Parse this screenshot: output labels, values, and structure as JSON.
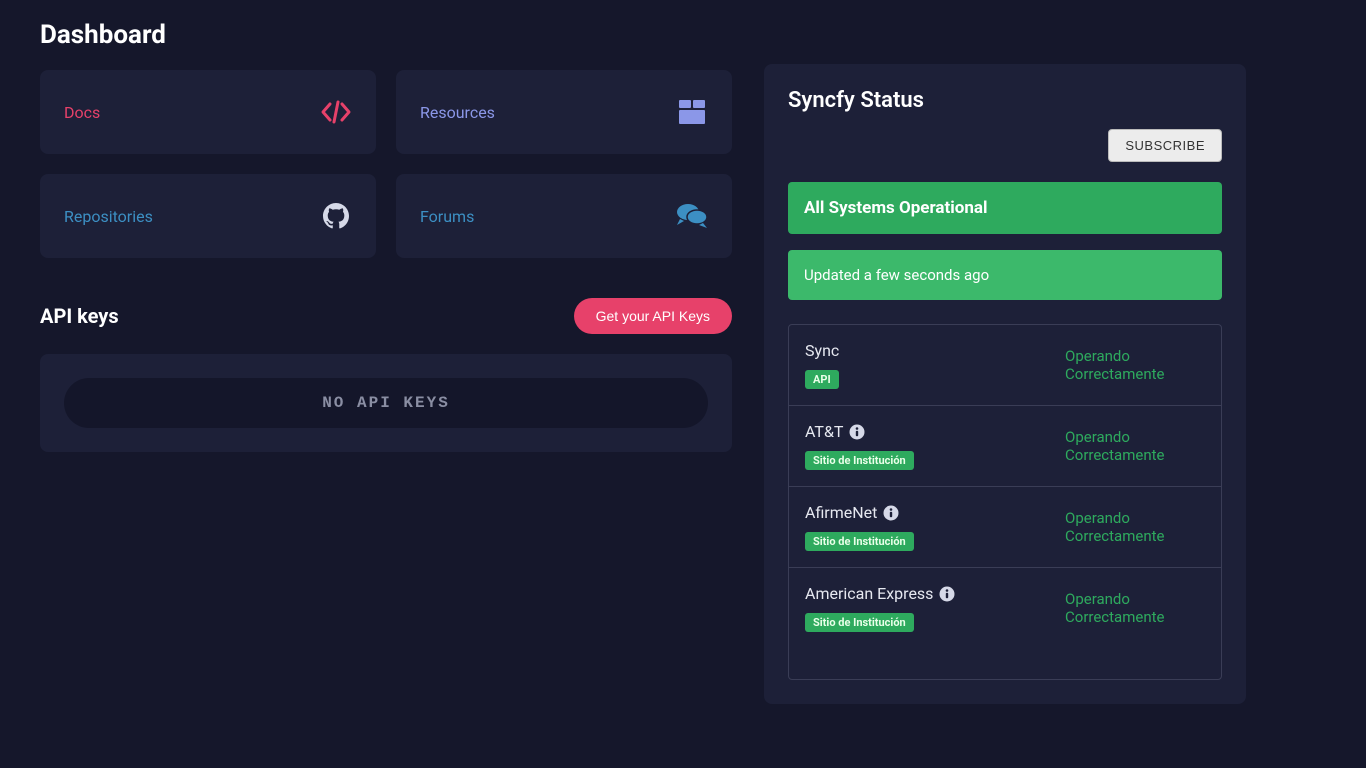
{
  "page_title": "Dashboard",
  "cards": {
    "docs": {
      "label": "Docs"
    },
    "resources": {
      "label": "Resources"
    },
    "repositories": {
      "label": "Repositories"
    },
    "forums": {
      "label": "Forums"
    }
  },
  "api_keys": {
    "section_title": "API keys",
    "get_button": "Get your API Keys",
    "no_keys_text": "NO API KEYS"
  },
  "status": {
    "title": "Syncfy Status",
    "subscribe_label": "SUBSCRIBE",
    "banner_text": "All Systems Operational",
    "updated_text": "Updated a few seconds ago",
    "services": [
      {
        "name": "Sync",
        "badge": "API",
        "status": "Operando Correctamente",
        "has_info": false
      },
      {
        "name": "AT&T",
        "badge": "Sitio de Institución",
        "status": "Operando Correctamente",
        "has_info": true
      },
      {
        "name": "AfirmeNet",
        "badge": "Sitio de Institución",
        "status": "Operando Correctamente",
        "has_info": true
      },
      {
        "name": "American Express",
        "badge": "Sitio de Institución",
        "status": "Operando Correctamente",
        "has_info": true
      }
    ]
  },
  "colors": {
    "pink": "#e7416a",
    "purple": "#8b97e8",
    "blue": "#3c8fc3",
    "green": "#2eaa5e"
  }
}
